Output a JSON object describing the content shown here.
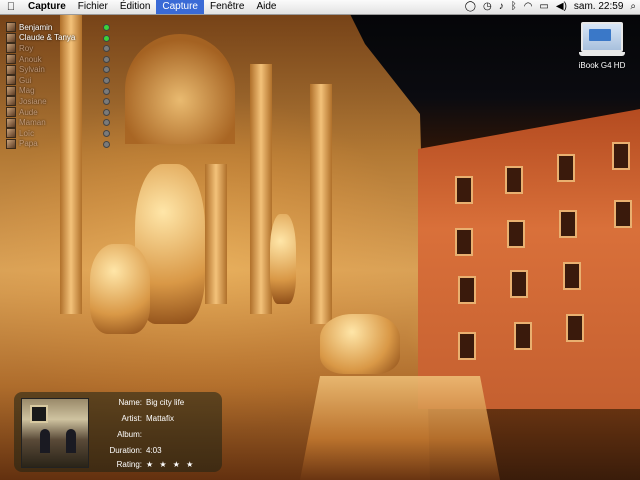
{
  "menubar": {
    "app_name": "Capture",
    "items": [
      "Fichier",
      "Édition",
      "Capture",
      "Fenêtre",
      "Aide"
    ],
    "active_item": "Capture",
    "clock": "sam. 22:59"
  },
  "desktop": {
    "disk_label": "iBook G4 HD"
  },
  "buddy_list": [
    {
      "name": "Benjamin",
      "status": "online"
    },
    {
      "name": "Claude & Tanya",
      "status": "online"
    },
    {
      "name": "Roy",
      "status": "offline"
    },
    {
      "name": "Anouk",
      "status": "offline"
    },
    {
      "name": "Sylvain",
      "status": "offline"
    },
    {
      "name": "Gui",
      "status": "offline"
    },
    {
      "name": "Mag",
      "status": "offline"
    },
    {
      "name": "Josiane",
      "status": "offline"
    },
    {
      "name": "Aude",
      "status": "offline"
    },
    {
      "name": "Maman",
      "status": "offline"
    },
    {
      "name": "Loïc",
      "status": "offline"
    },
    {
      "name": "Papa",
      "status": "offline"
    }
  ],
  "now_playing": {
    "name_label": "Name:",
    "name": "Big city life",
    "artist_label": "Artist:",
    "artist": "Mattafix",
    "album_label": "Album:",
    "album": "",
    "duration_label": "Duration:",
    "duration": "4:03",
    "rating_label": "Rating:",
    "rating": "★ ★ ★ ★",
    "rating_value": 4
  }
}
